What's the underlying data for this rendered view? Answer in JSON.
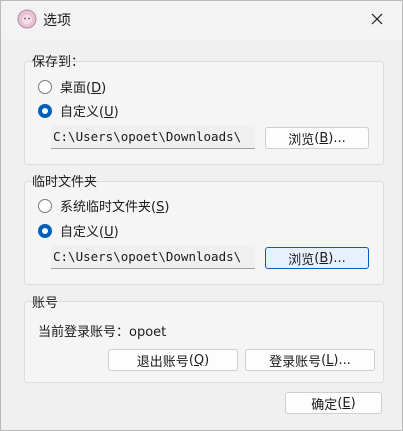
{
  "window": {
    "title": "选项"
  },
  "save_group": {
    "label": "保存到：",
    "options": [
      {
        "label": "桌面",
        "key": "D",
        "checked": false
      },
      {
        "label": "自定义",
        "key": "U",
        "checked": true
      }
    ],
    "path": "C:\\Users\\opoet\\Downloads\\",
    "browse": {
      "label": "浏览",
      "key": "B",
      "suffix": "..."
    }
  },
  "temp_group": {
    "label": "临时文件夹",
    "options": [
      {
        "label": "系统临时文件夹",
        "key": "S",
        "checked": false
      },
      {
        "label": "自定义",
        "key": "U",
        "checked": true
      }
    ],
    "path": "C:\\Users\\opoet\\Downloads\\",
    "browse": {
      "label": "浏览",
      "key": "B",
      "suffix": "..."
    }
  },
  "account_group": {
    "label": "账号",
    "current_label": "当前登录账号：",
    "current_user": "opoet",
    "logout": {
      "label": "退出账号",
      "key": "Q"
    },
    "login": {
      "label": "登录账号",
      "key": "L",
      "suffix": "..."
    }
  },
  "ok": {
    "label": "确定",
    "key": "E"
  }
}
